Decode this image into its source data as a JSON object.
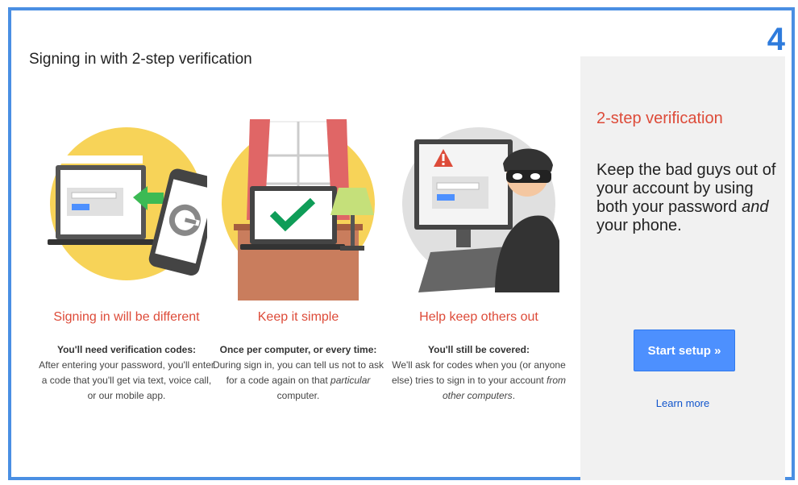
{
  "step_number": "4",
  "page": {
    "title": "Signing in with 2-step verification"
  },
  "features": [
    {
      "title": "Signing in will be different",
      "lead": "You'll need verification codes:",
      "desc": "After entering your password, you'll enter a code that you'll get via text, voice call, or our mobile app.",
      "icon": "phone-code-illustration"
    },
    {
      "title": "Keep it simple",
      "lead": "Once per computer, or every time:",
      "desc": "During sign in, you can tell us not to ask for a code again on that particular computer.",
      "icon": "laptop-check-illustration"
    },
    {
      "title": "Help keep others out",
      "lead": "You'll still be covered:",
      "desc": "We'll ask for codes when you (or anyone else) tries to sign in to your account from other computers.",
      "icon": "thief-illustration"
    }
  ],
  "side_panel": {
    "heading": "2-step verification",
    "text": "Keep the bad guys out of your account by using both your password and your phone.",
    "button": "Start setup »",
    "link": "Learn more"
  },
  "colors": {
    "frame": "#4a8fe3",
    "accent_red": "#dd4b39",
    "button_blue": "#4d90fe",
    "link_blue": "#1155cc",
    "panel_bg": "#f1f1f1"
  }
}
